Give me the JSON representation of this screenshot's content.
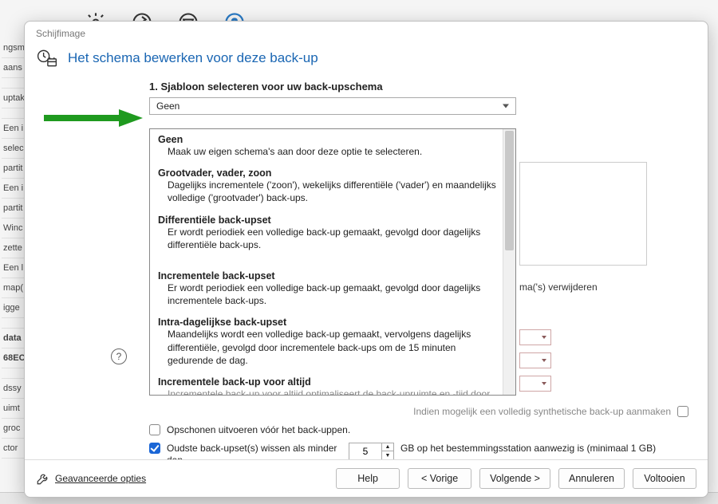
{
  "window_title": "Schijfimage",
  "header_title": "Het schema bewerken voor deze back-up",
  "step_heading": "1. Sjabloon selecteren voor uw back-upschema",
  "dropdown_selected": "Geen",
  "dropdown_options": [
    {
      "title": "Geen",
      "desc": "Maak uw eigen schema's aan door deze optie te selecteren."
    },
    {
      "title": "Grootvader, vader, zoon",
      "desc": "Dagelijks incrementele ('zoon'), wekelijks differentiële ('vader') en maandelijks volledige ('grootvader') back-ups."
    },
    {
      "title": "Differentiële back-upset",
      "desc": "Er wordt periodiek een volledige back-up gemaakt, gevolgd door dagelijks differentiële back-ups."
    },
    {
      "title": "Incrementele back-upset",
      "desc": "Er wordt periodiek een volledige back-up gemaakt, gevolgd door dagelijks incrementele back-ups."
    },
    {
      "title": "Intra-dagelijkse back-upset",
      "desc": "Maandelijks wordt een volledige back-up gemaakt, vervolgens dagelijks differentiële, gevolgd door incrementele back-ups om de 15 minuten gedurende de dag."
    },
    {
      "title": "Incrementele back-up voor altijd",
      "desc": "Incrementele back-up voor altijd optimaliseert de back-upruimte en -tijd door slechts één volledige back-up te maken."
    }
  ],
  "right_hint": "ma('s) verwijderen",
  "synthetic_label": "Indien mogelijk een volledig synthetische back-up aanmaken",
  "opt_cleanup": "Opschonen uitvoeren vóór het back-uppen.",
  "opt_delete_old": "Oudste back-upset(s) wissen als minder dan",
  "gb_value": "5",
  "gb_trail": "GB op het bestemmingsstation aanwezig is (minimaal 1 GB)",
  "advanced_label": "Geavanceerde opties",
  "buttons": {
    "help": "Help",
    "prev": "< Vorige",
    "next": "Volgende >",
    "cancel": "Annuleren",
    "finish": "Voltooien"
  },
  "bg_nav": [
    "ngsm",
    "aans",
    "",
    "uptak",
    "",
    "Een i",
    "selec",
    "partit",
    "Een i",
    "partit",
    "Winc",
    "zette",
    "Een l",
    "map(",
    "igge",
    "",
    "data",
    "68EC",
    "",
    "dssy",
    "uimt",
    "groc",
    "ctor"
  ]
}
